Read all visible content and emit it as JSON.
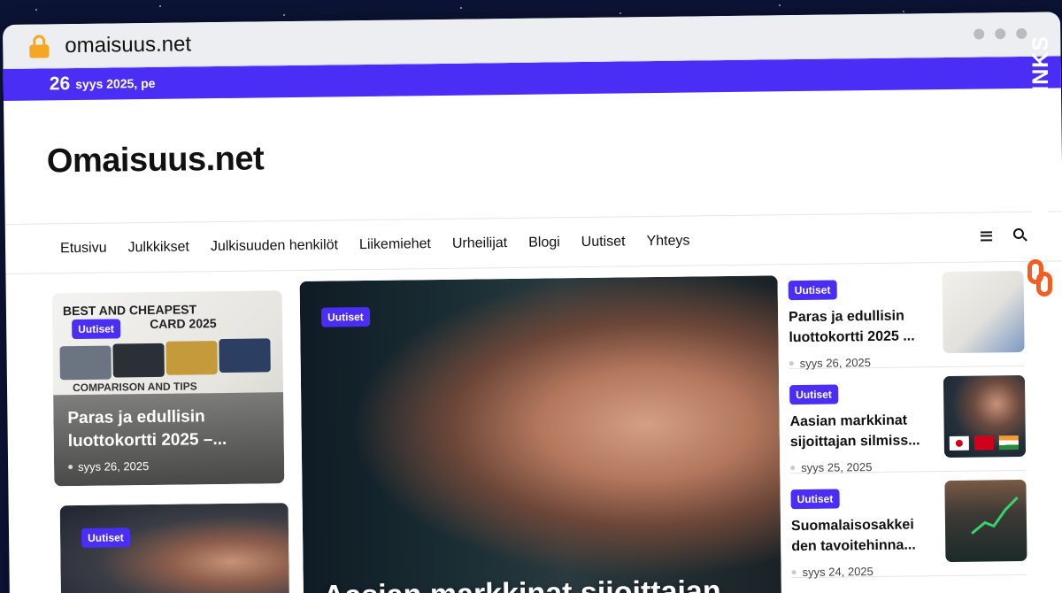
{
  "browser": {
    "url": "omaisuus.net"
  },
  "topbar": {
    "day": "26",
    "date": "syys 2025, pe"
  },
  "site": {
    "logo": "Omaisuus.net"
  },
  "nav": {
    "items": [
      "Etusivu",
      "Julkkikset",
      "Julkisuuden henkilöt",
      "Liikemiehet",
      "Urheilijat",
      "Blogi",
      "Uutiset",
      "Yhteys"
    ]
  },
  "cards": {
    "left_top": {
      "badge": "Uutiset",
      "image_text_1": "BEST AND CHEAPEST",
      "image_text_2": "CARD 2025",
      "image_text_3": "COMPARISON AND TIPS",
      "title": "Paras ja edullisin luottokortti 2025 –...",
      "date": "syys 26, 2025"
    },
    "left_bottom": {
      "badge": "Uutiset"
    },
    "hero": {
      "badge": "Uutiset",
      "title": "Aasian markkinat sijoittajan"
    }
  },
  "side": [
    {
      "badge": "Uutiset",
      "title": "Paras ja edullisin luottokortti 2025 ...",
      "date": "syys 26, 2025"
    },
    {
      "badge": "Uutiset",
      "title": "Aasian markkinat sijoittajan silmiss...",
      "date": "syys 25, 2025"
    },
    {
      "badge": "Uutiset",
      "title": "Suomalaisosakkei den tavoitehinna...",
      "date": "syys 24, 2025"
    }
  ],
  "branding": {
    "text": "GUESTPOSTLINKS"
  },
  "colors": {
    "accent": "#4b2ef5",
    "brand_orange": "#f25d22"
  }
}
